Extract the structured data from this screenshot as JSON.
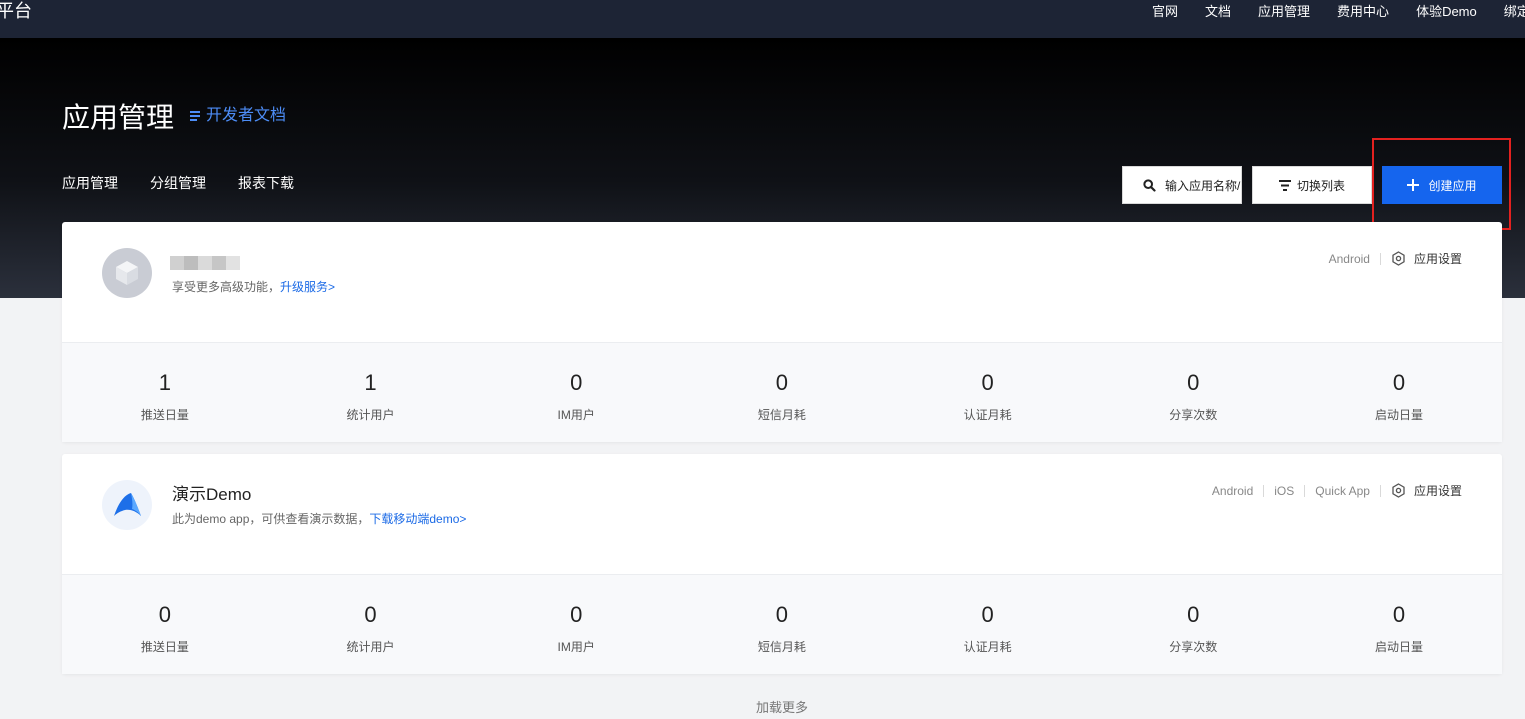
{
  "topnav": {
    "brand": "平台",
    "links": [
      "官网",
      "文档",
      "应用管理",
      "费用中心",
      "体验Demo",
      "绑定微"
    ]
  },
  "header": {
    "title": "应用管理",
    "dev_doc": "开发者文档",
    "tabs": [
      "应用管理",
      "分组管理",
      "报表下载"
    ],
    "search_text": "输入应用名称/",
    "switch_label": "切换列表",
    "create_label": "创建应用"
  },
  "apps": [
    {
      "name": "",
      "desc": "享受更多高级功能，",
      "desc_link": "升级服务>",
      "platforms": [
        "Android"
      ],
      "settings_label": "应用设置",
      "stats": [
        {
          "value": "1",
          "label": "推送日量"
        },
        {
          "value": "1",
          "label": "统计用户"
        },
        {
          "value": "0",
          "label": "IM用户"
        },
        {
          "value": "0",
          "label": "短信月耗"
        },
        {
          "value": "0",
          "label": "认证月耗"
        },
        {
          "value": "0",
          "label": "分享次数"
        },
        {
          "value": "0",
          "label": "启动日量"
        }
      ]
    },
    {
      "name": "演示Demo",
      "desc": "此为demo app，可供查看演示数据，",
      "desc_link": "下载移动端demo>",
      "platforms": [
        "Android",
        "iOS",
        "Quick App"
      ],
      "settings_label": "应用设置",
      "stats": [
        {
          "value": "0",
          "label": "推送日量"
        },
        {
          "value": "0",
          "label": "统计用户"
        },
        {
          "value": "0",
          "label": "IM用户"
        },
        {
          "value": "0",
          "label": "短信月耗"
        },
        {
          "value": "0",
          "label": "认证月耗"
        },
        {
          "value": "0",
          "label": "分享次数"
        },
        {
          "value": "0",
          "label": "启动日量"
        }
      ]
    }
  ],
  "load_more": "加载更多",
  "colors": {
    "nav_bg": "#1d2435",
    "primary": "#1565ee",
    "link": "#1b6ae6",
    "highlight": "#e3211f"
  }
}
